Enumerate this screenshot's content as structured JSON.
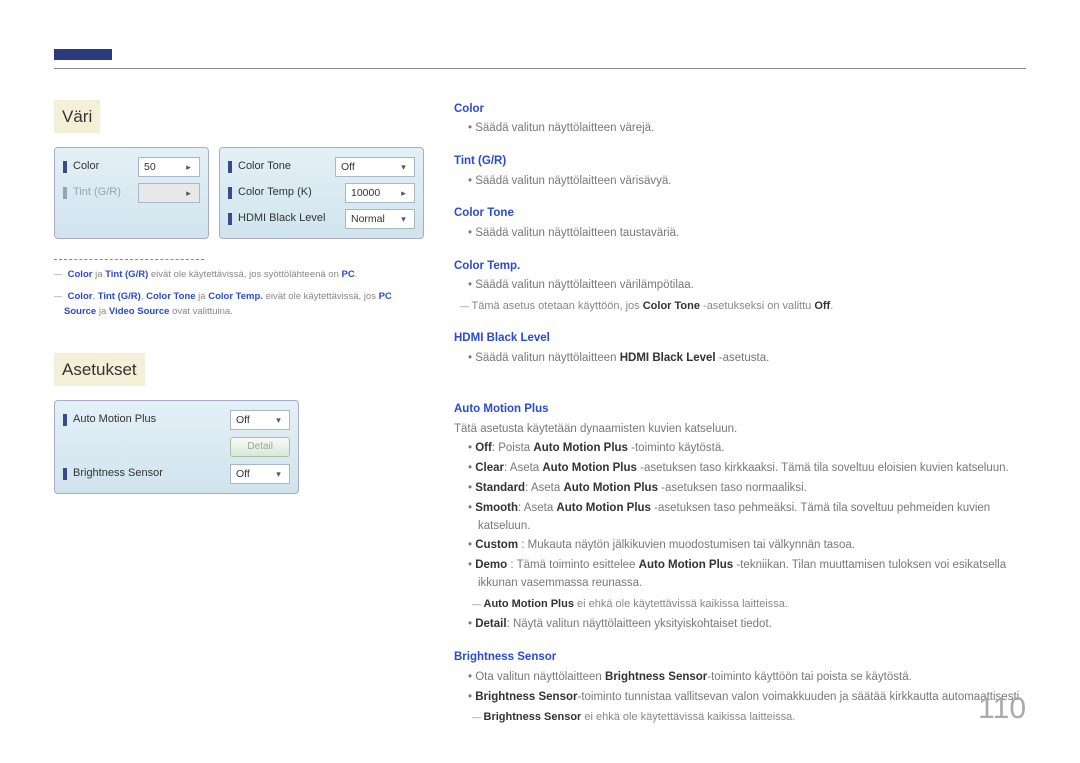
{
  "page_number": "110",
  "left": {
    "section1_title": "Väri",
    "panelA": {
      "row1_label": "Color",
      "row1_value": "50",
      "row2_label": "Tint (G/R)"
    },
    "panelB": {
      "row1_label": "Color Tone",
      "row1_value": "Off",
      "row2_label": "Color Temp (K)",
      "row2_value": "10000",
      "row3_label": "HDMI Black Level",
      "row3_value": "Normal"
    },
    "note1": {
      "k1": "Color",
      "mid1": " ja ",
      "k2": "Tint (G/R)",
      "text": " eivät ole käytettävissä, jos syöttölähteenä on ",
      "k3": "PC",
      "end": "."
    },
    "note2": {
      "k1": "Color",
      "s1": ", ",
      "k2": "Tint (G/R)",
      "s2": ", ",
      "k3": "Color Tone",
      "mid": " ja ",
      "k4": "Color Temp.",
      "text": " eivät ole käytettävissä, jos ",
      "k5": "PC Source",
      "mid2": " ja ",
      "k6": "Video Source",
      "end": " ovat valittuina."
    },
    "section2_title": "Asetukset",
    "panelC": {
      "row1_label": "Auto Motion Plus",
      "row1_value": "Off",
      "detail_btn": "Detail",
      "row2_label": "Brightness Sensor",
      "row2_value": "Off"
    }
  },
  "right": {
    "color": {
      "h": "Color",
      "b1": "Säädä valitun näyttölaitteen värejä."
    },
    "tint": {
      "h": "Tint (G/R)",
      "b1": "Säädä valitun näyttölaitteen värisävyä."
    },
    "colortone": {
      "h": "Color Tone",
      "b1": "Säädä valitun näyttölaitteen taustaväriä."
    },
    "colortemp": {
      "h": "Color Temp.",
      "b1": "Säädä valitun näyttölaitteen värilämpötilaa.",
      "d1_pre": "Tämä asetus otetaan käyttöön, jos ",
      "d1_kw": "Color Tone",
      "d1_mid": " -asetukseksi on valittu ",
      "d1_kw2": "Off",
      "d1_end": "."
    },
    "hdmi": {
      "h": "HDMI Black Level",
      "b1_pre": "Säädä valitun näyttölaitteen ",
      "b1_kw": "HDMI Black Level",
      "b1_end": " -asetusta."
    },
    "amp": {
      "h": "Auto Motion Plus",
      "intro": "Tätä asetusta käytetään dynaamisten kuvien katseluun.",
      "b1_k": "Off",
      "b1_t_pre": ": Poista ",
      "b1_t_kw": "Auto Motion Plus",
      "b1_t_end": " -toiminto käytöstä.",
      "b2_k": "Clear",
      "b2_t_pre": ": Aseta ",
      "b2_t_kw": "Auto Motion Plus",
      "b2_t_end": " -asetuksen taso kirkkaaksi. Tämä tila soveltuu eloisien kuvien katseluun.",
      "b3_k": "Standard",
      "b3_t_pre": ": Aseta ",
      "b3_t_kw": "Auto Motion Plus",
      "b3_t_end": " -asetuksen taso normaaliksi.",
      "b4_k": "Smooth",
      "b4_t_pre": ": Aseta ",
      "b4_t_kw": "Auto Motion Plus",
      "b4_t_end": " -asetuksen taso pehmeäksi. Tämä tila soveltuu pehmeiden kuvien katseluun.",
      "b5_k": "Custom",
      "b5_t": " : Mukauta näytön jälkikuvien muodostumisen tai välkynnän tasoa.",
      "b6_k": "Demo",
      "b6_t_pre": " : Tämä toiminto esittelee ",
      "b6_t_kw": "Auto Motion Plus",
      "b6_t_end": " -tekniikan. Tilan muuttamisen tuloksen voi esikatsella ikkunan vasemmassa reunassa.",
      "d1_kw": "Auto Motion Plus",
      "d1_t": " ei ehkä ole käytettävissä kaikissa laitteissa.",
      "b7_k": "Detail",
      "b7_t": ": Näytä valitun näyttölaitteen yksityiskohtaiset tiedot."
    },
    "bs": {
      "h": "Brightness Sensor",
      "b1_pre": "Ota valitun näyttölaitteen ",
      "b1_kw": "Brightness Sensor",
      "b1_end": "-toiminto käyttöön tai poista se käytöstä.",
      "b2_kw": "Brightness Sensor",
      "b2_end": "-toiminto tunnistaa vallitsevan valon voimakkuuden ja säätää kirkkautta automaattisesti.",
      "d1_kw": "Brightness Sensor",
      "d1_t": " ei ehkä ole käytettävissä kaikissa laitteissa."
    }
  }
}
